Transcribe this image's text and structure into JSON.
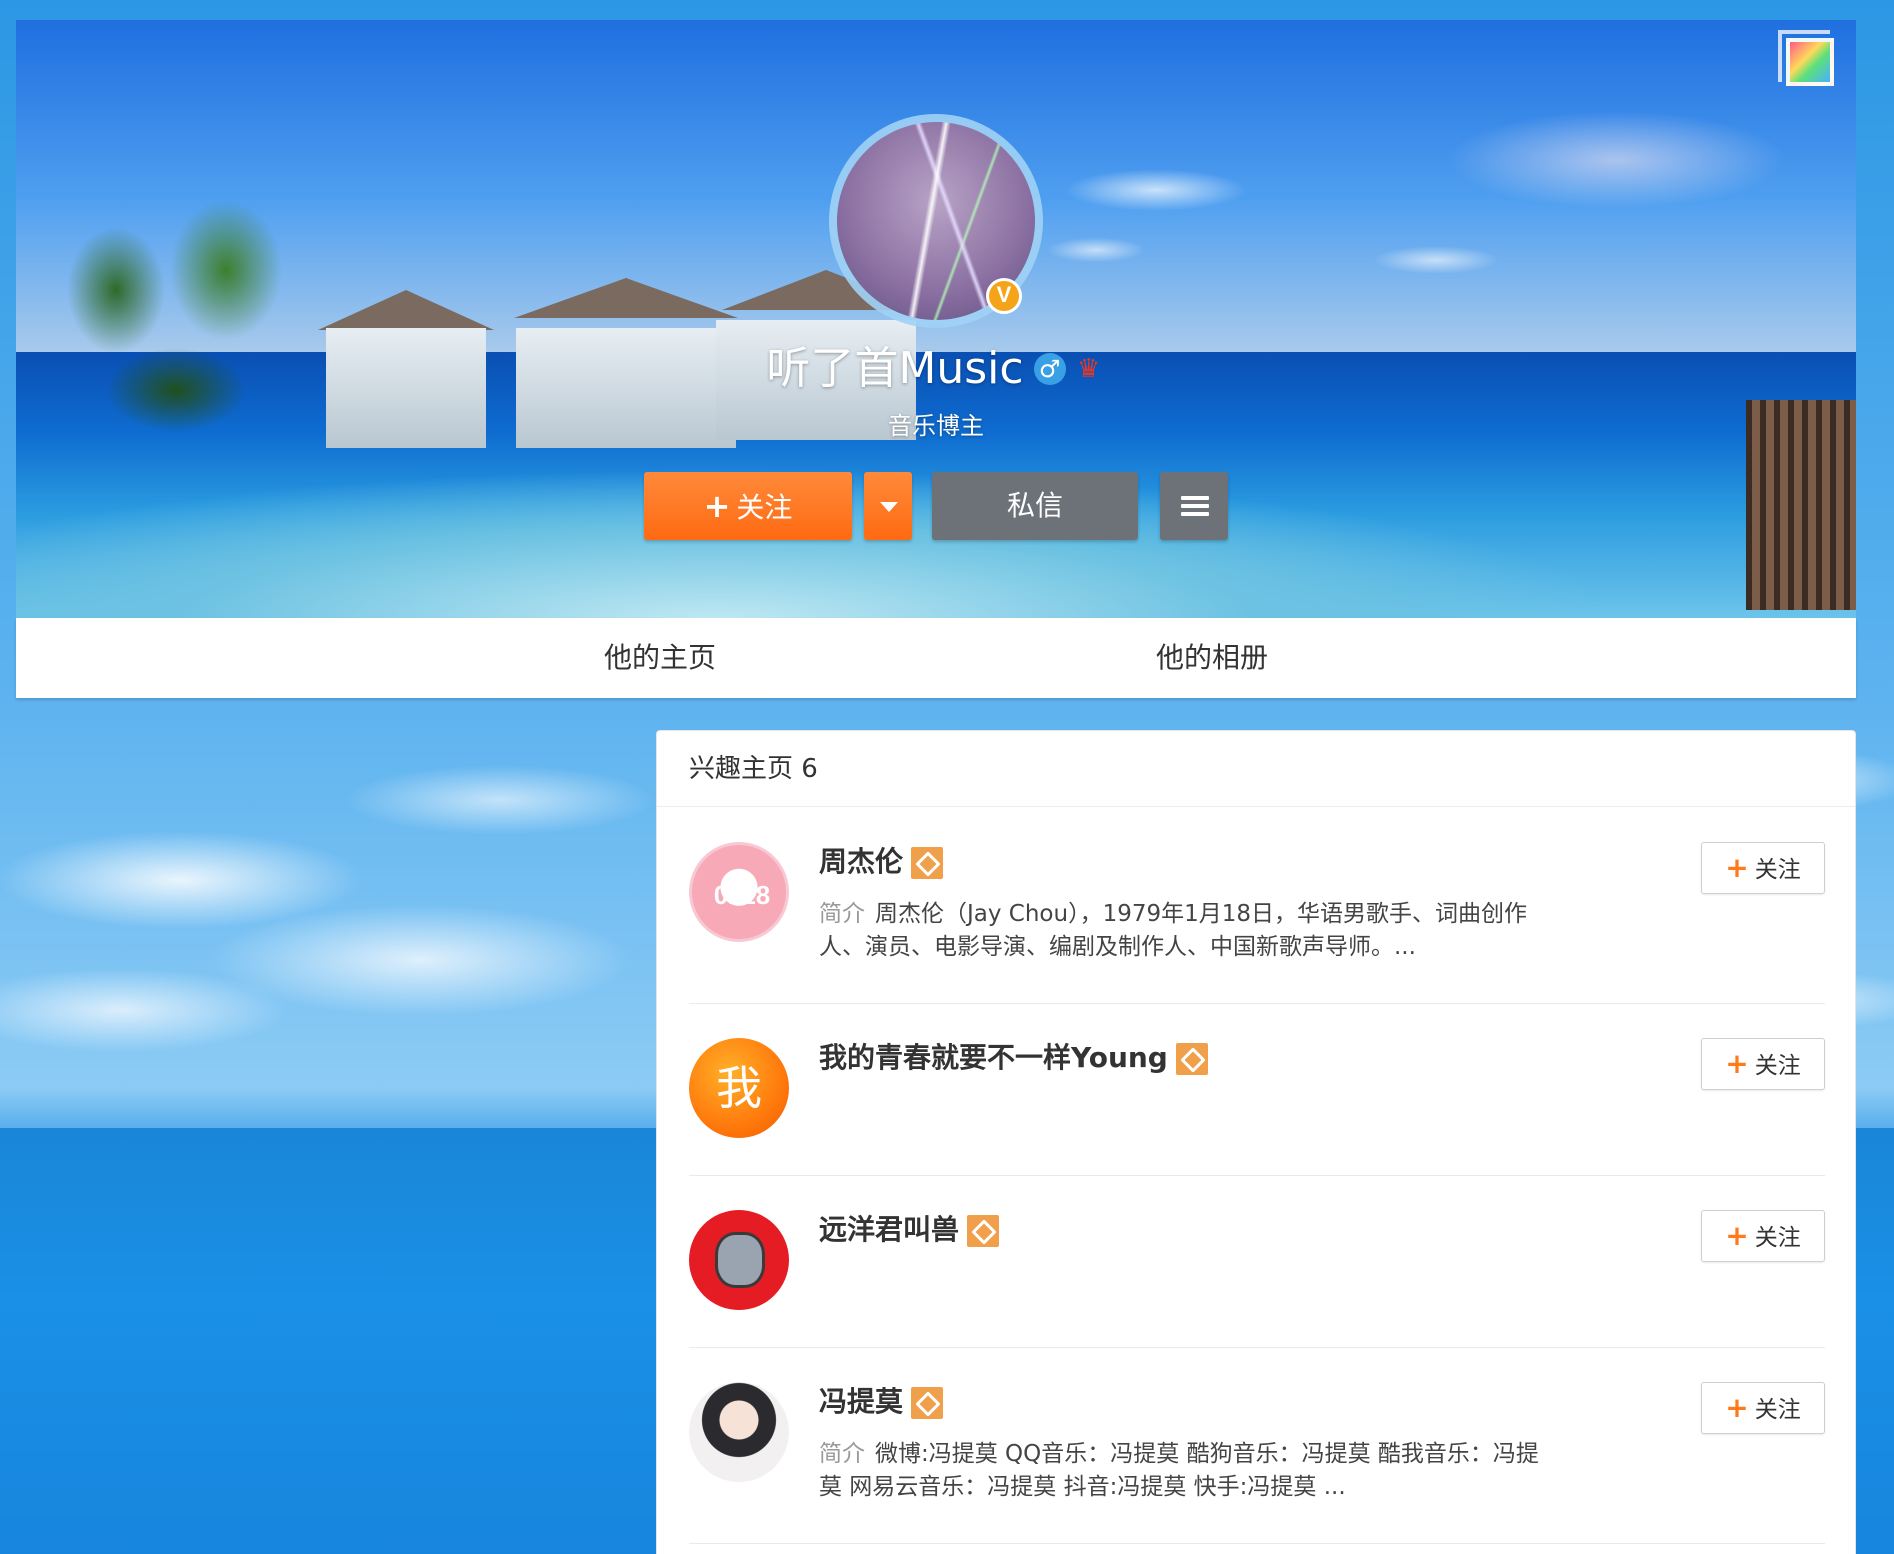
{
  "profile": {
    "name": "听了首Music",
    "description": "音乐博主",
    "verified_badge": "V",
    "gender_icon": "male-icon",
    "member_icon": "crown-icon"
  },
  "actions": {
    "follow_label": "关注",
    "message_label": "私信"
  },
  "tabs": [
    {
      "label": "他的主页"
    },
    {
      "label": "他的相册"
    }
  ],
  "interest": {
    "title": "兴趣主页 6",
    "items": [
      {
        "name": "周杰伦",
        "intro_label": "简介",
        "intro": "周杰伦（Jay Chou），1979年1月18日，华语男歌手、词曲创作人、演员、电影导演、编剧及制作人、中国新歌声导师。...",
        "avatar_text": "0118",
        "follow_label": "关注"
      },
      {
        "name": "我的青春就要不一样Young",
        "avatar_text": "我",
        "follow_label": "关注"
      },
      {
        "name": "远洋君叫兽",
        "follow_label": "关注"
      },
      {
        "name": "冯提莫",
        "intro_label": "简介",
        "intro": "微博:冯提莫 QQ音乐：冯提莫 酷狗音乐：冯提莫 酷我音乐：冯提莫 网易云音乐：冯提莫 抖音:冯提莫 快手:冯提莫 ...",
        "follow_label": "关注"
      }
    ]
  },
  "colors": {
    "follow_orange": "#ff6a12",
    "neutral_button": "#6d7178",
    "gem_badge": "#f0a04a"
  }
}
